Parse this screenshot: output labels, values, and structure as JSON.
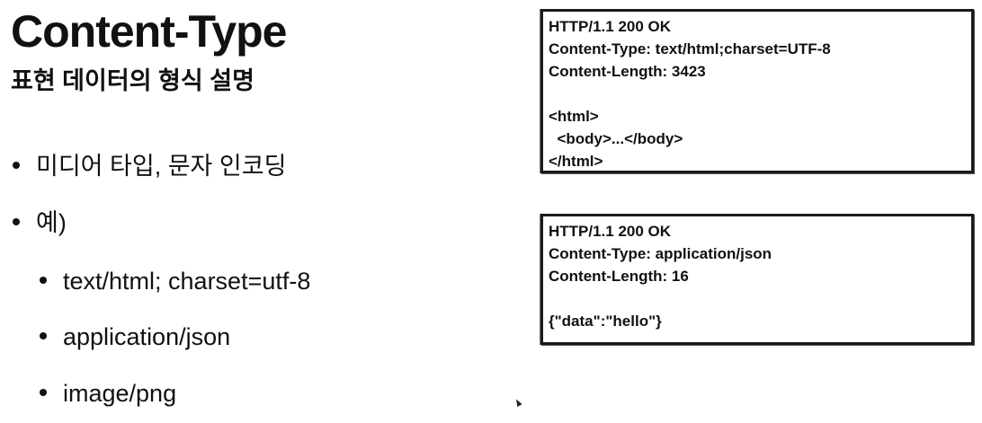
{
  "slide": {
    "title": "Content-Type",
    "subtitle": "표현 데이터의 형식 설명"
  },
  "bullets": [
    {
      "text": "미디어 타입, 문자 인코딩",
      "level": 1
    },
    {
      "text": "예)",
      "level": 1
    },
    {
      "text": "text/html; charset=utf-8",
      "level": 2
    },
    {
      "text": "application/json",
      "level": 2
    },
    {
      "text": "image/png",
      "level": 2
    }
  ],
  "http_examples": [
    {
      "lines": [
        "HTTP/1.1 200 OK",
        "Content-Type: text/html;charset=UTF-8",
        "Content-Length: 3423",
        "",
        "<html>",
        "  <body>...</body>",
        "</html>"
      ]
    },
    {
      "lines": [
        "HTTP/1.1 200 OK",
        "Content-Type: application/json",
        "Content-Length: 16",
        "",
        "{\"data\":\"hello\"}"
      ]
    }
  ],
  "icons": {
    "cursor": "mouse-pointer-icon"
  }
}
